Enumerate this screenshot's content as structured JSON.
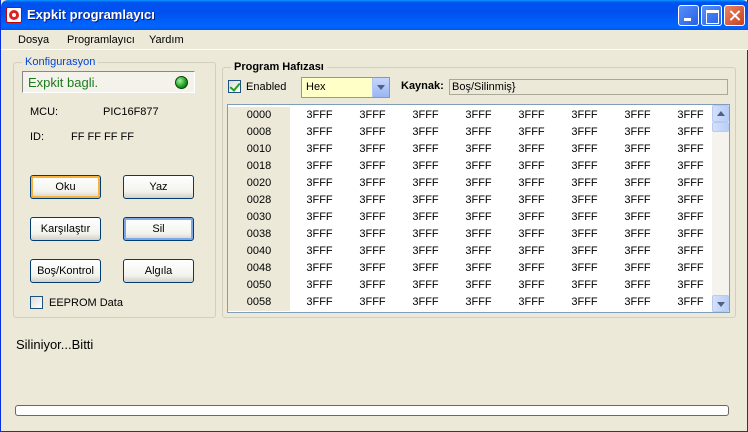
{
  "window": {
    "title": "Expkit programlayıcı"
  },
  "menu": [
    "Dosya",
    "Programlayıcı",
    "Yardım"
  ],
  "config": {
    "group_title": "Konfigurasyon",
    "status": "Expkit bagli.",
    "mcu_label": "MCU:",
    "mcu_value": "PIC16F877",
    "id_label": "ID:",
    "id_value": "FF FF FF FF",
    "buttons": {
      "read": "Oku",
      "write": "Yaz",
      "compare": "Karşılaştır",
      "erase": "Sil",
      "blank_check": "Boş/Kontrol",
      "detect": "Algıla"
    },
    "eeprom_label": "EEPROM Data",
    "eeprom_checked": false
  },
  "program": {
    "group_title": "Program Hafızası",
    "enabled_label": "Enabled",
    "enabled_checked": true,
    "format": "Hex",
    "source_label": "Kaynak:",
    "source_value": "Boş/Silinmiş}",
    "rows": [
      {
        "addr": "0000",
        "cells": [
          "3FFF",
          "3FFF",
          "3FFF",
          "3FFF",
          "3FFF",
          "3FFF",
          "3FFF",
          "3FFF"
        ]
      },
      {
        "addr": "0008",
        "cells": [
          "3FFF",
          "3FFF",
          "3FFF",
          "3FFF",
          "3FFF",
          "3FFF",
          "3FFF",
          "3FFF"
        ]
      },
      {
        "addr": "0010",
        "cells": [
          "3FFF",
          "3FFF",
          "3FFF",
          "3FFF",
          "3FFF",
          "3FFF",
          "3FFF",
          "3FFF"
        ]
      },
      {
        "addr": "0018",
        "cells": [
          "3FFF",
          "3FFF",
          "3FFF",
          "3FFF",
          "3FFF",
          "3FFF",
          "3FFF",
          "3FFF"
        ]
      },
      {
        "addr": "0020",
        "cells": [
          "3FFF",
          "3FFF",
          "3FFF",
          "3FFF",
          "3FFF",
          "3FFF",
          "3FFF",
          "3FFF"
        ]
      },
      {
        "addr": "0028",
        "cells": [
          "3FFF",
          "3FFF",
          "3FFF",
          "3FFF",
          "3FFF",
          "3FFF",
          "3FFF",
          "3FFF"
        ]
      },
      {
        "addr": "0030",
        "cells": [
          "3FFF",
          "3FFF",
          "3FFF",
          "3FFF",
          "3FFF",
          "3FFF",
          "3FFF",
          "3FFF"
        ]
      },
      {
        "addr": "0038",
        "cells": [
          "3FFF",
          "3FFF",
          "3FFF",
          "3FFF",
          "3FFF",
          "3FFF",
          "3FFF",
          "3FFF"
        ]
      },
      {
        "addr": "0040",
        "cells": [
          "3FFF",
          "3FFF",
          "3FFF",
          "3FFF",
          "3FFF",
          "3FFF",
          "3FFF",
          "3FFF"
        ]
      },
      {
        "addr": "0048",
        "cells": [
          "3FFF",
          "3FFF",
          "3FFF",
          "3FFF",
          "3FFF",
          "3FFF",
          "3FFF",
          "3FFF"
        ]
      },
      {
        "addr": "0050",
        "cells": [
          "3FFF",
          "3FFF",
          "3FFF",
          "3FFF",
          "3FFF",
          "3FFF",
          "3FFF",
          "3FFF"
        ]
      },
      {
        "addr": "0058",
        "cells": [
          "3FFF",
          "3FFF",
          "3FFF",
          "3FFF",
          "3FFF",
          "3FFF",
          "3FFF",
          "3FFF"
        ]
      }
    ]
  },
  "status_message": "Siliniyor...Bitti",
  "progress": 0,
  "colors": {
    "titlebar": "#0054e3",
    "status_text": "#1e7a1e",
    "led": "#1a9a1a",
    "combo_bg": "#ffffc8"
  }
}
